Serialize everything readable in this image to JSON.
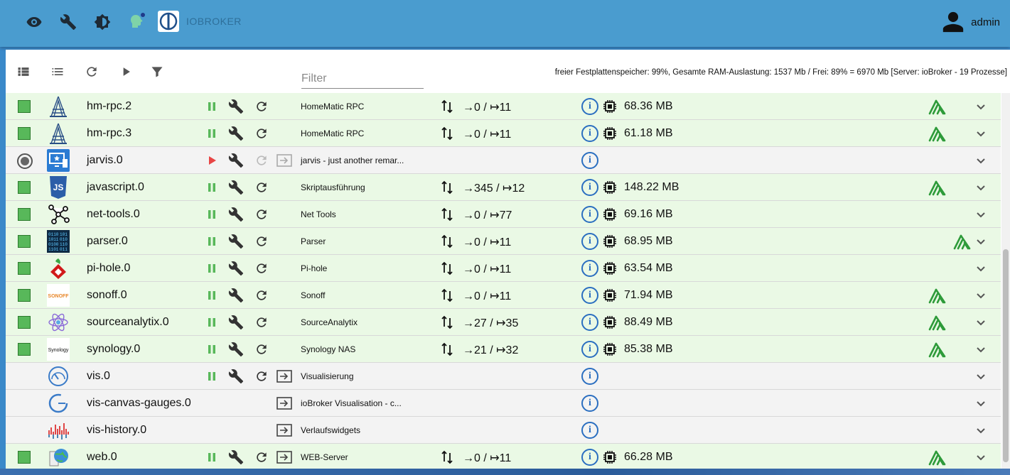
{
  "topbar": {
    "brand": "IOBROKER",
    "user": "admin",
    "icons": [
      "eye-icon",
      "wrench-icon",
      "brightness-icon",
      "expert-mode-icon"
    ]
  },
  "toolbar": {
    "filter_placeholder": "Filter",
    "status": "freier Festplattenspeicher: 99%, Gesamte RAM-Auslastung: 1537 Mb / Frei: 89% = 6970 Mb [Server: ioBroker - 19 Prozesse]"
  },
  "colors": {
    "header": "#4a9ccf",
    "running_row": "#eaf9e5",
    "stopped_row": "#f3f3f3",
    "info": "#2a6ec0",
    "signal": "#2e9b3a"
  },
  "instances": [
    {
      "name": "hm-rpc.2",
      "title": "HomeMatic RPC",
      "events": "→0 / ↦11",
      "memory": "68.36 MB"
    },
    {
      "name": "hm-rpc.3",
      "title": "HomeMatic RPC",
      "events": "→0 / ↦11",
      "memory": "61.18 MB"
    },
    {
      "name": "jarvis.0",
      "title": "jarvis - just another remar...",
      "events": "",
      "memory": ""
    },
    {
      "name": "javascript.0",
      "title": "Skriptausführung",
      "events": "→345 / ↦12",
      "memory": "148.22 MB"
    },
    {
      "name": "net-tools.0",
      "title": "Net Tools",
      "events": "→0 / ↦77",
      "memory": "69.16 MB"
    },
    {
      "name": "parser.0",
      "title": "Parser",
      "events": "→0 / ↦11",
      "memory": "68.95 MB"
    },
    {
      "name": "pi-hole.0",
      "title": "Pi-hole",
      "events": "→0 / ↦11",
      "memory": "63.54 MB"
    },
    {
      "name": "sonoff.0",
      "title": "Sonoff",
      "events": "→0 / ↦11",
      "memory": "71.94 MB"
    },
    {
      "name": "sourceanalytix.0",
      "title": "SourceAnalytix",
      "events": "→27 / ↦35",
      "memory": "88.49 MB"
    },
    {
      "name": "synology.0",
      "title": "Synology NAS",
      "events": "→21 / ↦32",
      "memory": "85.38 MB"
    },
    {
      "name": "vis.0",
      "title": "Visualisierung",
      "events": "",
      "memory": ""
    },
    {
      "name": "vis-canvas-gauges.0",
      "title": "ioBroker Visualisation - c...",
      "events": "",
      "memory": ""
    },
    {
      "name": "vis-history.0",
      "title": "Verlaufswidgets",
      "events": "",
      "memory": ""
    },
    {
      "name": "web.0",
      "title": "WEB-Server",
      "events": "→0 / ↦11",
      "memory": "66.28 MB"
    }
  ],
  "app_icon_labels": {
    "sonoff": "SONOFF",
    "synology": "Synology",
    "javascript": "JS"
  }
}
